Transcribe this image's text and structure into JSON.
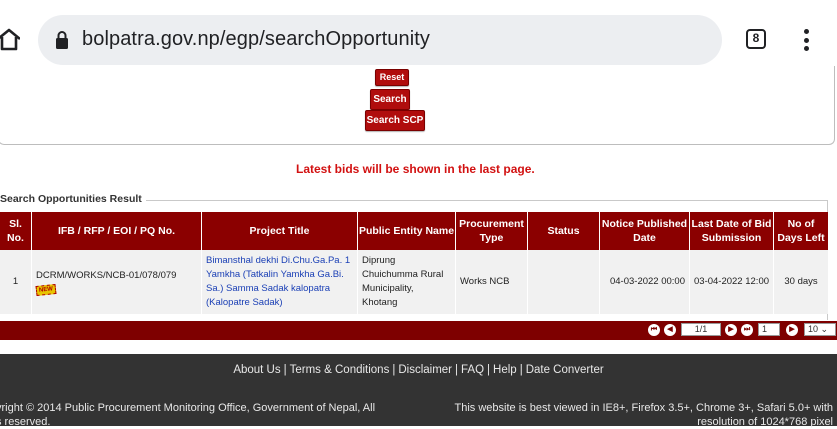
{
  "browser": {
    "url": "bolpatra.gov.np/egp/searchOpportunity",
    "tab_count": "8"
  },
  "form": {
    "reset_label": "Reset",
    "search_label": "Search",
    "search_scp_label": "Search SCP"
  },
  "notice": "Latest bids will be shown in the last page.",
  "results": {
    "legend": "Search Opportunities Result",
    "headers": {
      "sl_no": "Sl. No.",
      "ifb": "IFB / RFP / EOI / PQ No.",
      "project_title": "Project Title",
      "public_entity": "Public Entity Name",
      "procurement_type": "Procurement Type",
      "status": "Status",
      "notice_published": "Notice Published Date",
      "last_date": "Last Date of Bid Submission",
      "days_left": "No of Days Left"
    },
    "rows": [
      {
        "sl_no": "1",
        "ifb": "DCRM/WORKS/NCB-01/078/079",
        "badge": "NEW",
        "project_title": "Bimansthal dekhi Di.Chu.Ga.Pa. 1 Yamkha (Tatkalin Yamkha Ga.Bi. Sa.) Samma Sadak kalopatra (Kalopatre Sadak)",
        "public_entity": "Diprung Chuichumma Rural Municipality, Khotang",
        "procurement_type": "Works NCB",
        "status": "",
        "notice_published": "04-03-2022 00:00",
        "last_date": "03-04-2022 12:00",
        "days_left": "30 days"
      }
    ]
  },
  "pager": {
    "page_display": "1/1",
    "page_input": "1",
    "page_size": "10"
  },
  "footer": {
    "links": [
      "About Us",
      "Terms & Conditions",
      "Disclaimer",
      "FAQ",
      "Help",
      "Date Converter"
    ],
    "separator": "|",
    "copyright_line1": "yright © 2014 Public Procurement Monitoring Office, Government of Nepal, All",
    "copyright_line2": "s reserved.",
    "best_view_line1": "This website is best viewed in IE8+, Firefox 3.5+, Chrome 3+, Safari 5.0+ with",
    "best_view_line2": "resolution of 1024*768 pixel"
  },
  "colors": {
    "header_red": "#8b0000",
    "button_red": "#b00d0d",
    "notice_red": "#d21111",
    "link_blue": "#1a3fb5",
    "footer_bg": "#333333"
  }
}
